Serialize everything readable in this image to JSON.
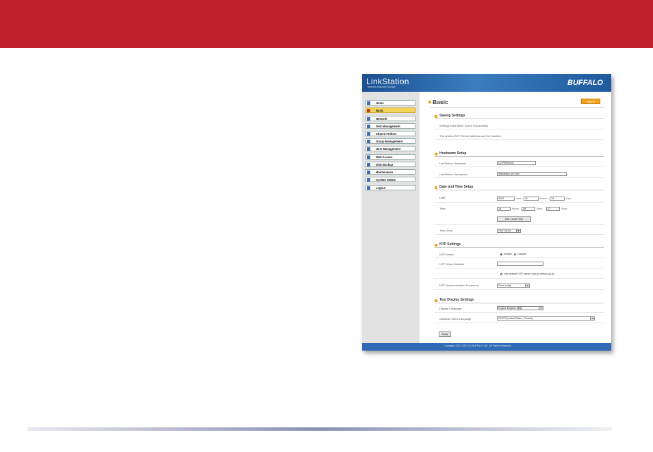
{
  "colors": {
    "banner": "#c01f2d",
    "header": "#2f6ab4",
    "accent": "#e8a21a"
  },
  "app": {
    "logo": "LinkStation",
    "tagline": "Network Attached Storage",
    "brand": "BUFFALO",
    "copyright": "Copyright 2002-2007 (C) BUFFALO INC. All Rights Reserved."
  },
  "sidebar": {
    "items": [
      {
        "label": "Home"
      },
      {
        "label": "Basic"
      },
      {
        "label": "Network"
      },
      {
        "label": "Disk Management"
      },
      {
        "label": "Shared Folders"
      },
      {
        "label": "Group Management"
      },
      {
        "label": "User Management"
      },
      {
        "label": "Web Access"
      },
      {
        "label": "Disk Backup"
      },
      {
        "label": "Maintenance"
      },
      {
        "label": "System Status"
      },
      {
        "label": "Logout"
      }
    ],
    "active": "Basic"
  },
  "page": {
    "title": "Basic",
    "help": "HELP"
  },
  "saving": {
    "title": "Saving Settings",
    "msg1": "Settings Have Been Saved Successfully",
    "msg2": "The entered NTP Server Address can't be reached."
  },
  "hostname": {
    "title": "Hostname Setup",
    "host_label": "LinkStation Hostname",
    "host_value": "LS-PRODUO",
    "desc_label": "LinkStation Description",
    "desc_value": "linkstation pro duo"
  },
  "datetime": {
    "title": "Date and Time Setup",
    "date_label": "Date",
    "year": "2007",
    "year_unit": "Year",
    "month": "11",
    "month_unit": "Month",
    "day": "14",
    "day_unit": "Day",
    "time_label": "Time",
    "hours": "14",
    "hours_unit": "Hours",
    "mins": "49",
    "mins_unit": "Mins",
    "secs": "17",
    "secs_unit": "Secs",
    "local_time_btn": "Use Local Time",
    "tz_label": "Time Zone",
    "tz_value": "GMT-06:00"
  },
  "ntp": {
    "title": "NTP Settings",
    "server_label": "NTP Server",
    "enable": "Enable",
    "disable": "Disable",
    "address_label": "NTP Server Address",
    "address_value": "",
    "default_label": "Use default NTP server (ntp.jst.mfeed.ad.jp)",
    "freq_label": "NTP Synchronization Frequency",
    "freq_value": "Once a day"
  },
  "text_display": {
    "title": "Text Display Settings",
    "lang_label": "Display Language",
    "lang_value": "English Englisch 英語",
    "client_label": "Windows Client Language",
    "client_value": "CP437 (United States, Canada)"
  },
  "apply": "Apply"
}
